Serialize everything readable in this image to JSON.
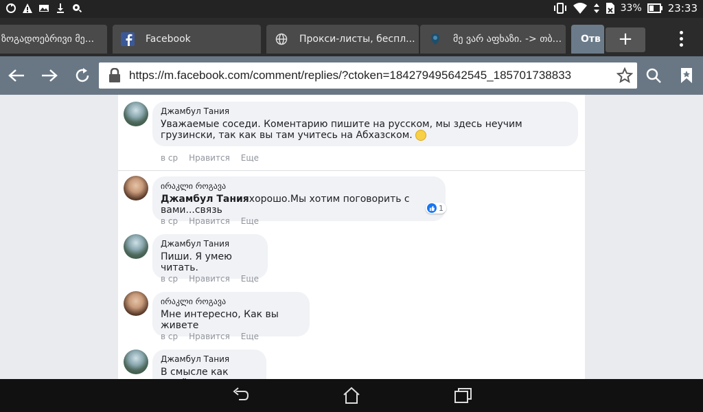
{
  "status": {
    "battery_percent": "33%",
    "time": "23:33"
  },
  "tabs": [
    {
      "title": "ზოგადოებრივი მე...",
      "active": false
    },
    {
      "title": "Facebook",
      "active": false
    },
    {
      "title": "Прокси-листы, беспл...",
      "active": false
    },
    {
      "title": "მე ვარ აფხაზი. -> თბ...",
      "active": false
    },
    {
      "title": "Отв",
      "active": true
    }
  ],
  "toolbar": {
    "url": "https://m.facebook.com/comment/replies/?ctoken=184279495642545_185701738833"
  },
  "comments": [
    {
      "author": "Джамбул Тания",
      "text": "Уважаемые соседи. Коментарию пишите на русском, мы здесь неучим грузински, так как вы там учитесь на Абхазском.",
      "time": "в ср",
      "like": "Нравится",
      "more": "Еще"
    },
    {
      "author": "ირაკლი როგავა",
      "mention": "Джамбул Тания",
      "text": "хорошо.Мы хотим поговорить с вами...связь",
      "reactions": "1",
      "time": "в ср",
      "like": "Нравится",
      "more": "Еще"
    },
    {
      "author": "Джамбул Тания",
      "text": "Пиши. Я умею читать.",
      "time": "в ср",
      "like": "Нравится",
      "more": "Еще"
    },
    {
      "author": "ირაკლი როგავა",
      "text": "Мне интересно, Как вы живете",
      "time": "в ср",
      "like": "Нравится",
      "more": "Еще"
    },
    {
      "author": "Джамбул Тания",
      "text": "В смысле как живёте"
    }
  ],
  "colors": {
    "toolbar": "#697785",
    "facebook_blue": "#3b5998",
    "like_blue": "#1877f2"
  }
}
